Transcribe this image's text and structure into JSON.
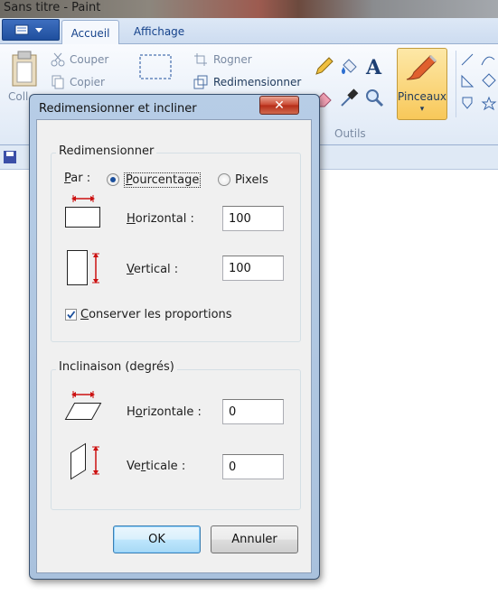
{
  "app": {
    "title": "Sans titre - Paint",
    "tabs": {
      "home": "Accueil",
      "view": "Affichage"
    },
    "ribbon": {
      "cut": "Couper",
      "copy": "Copier",
      "paste_partial": "Coll",
      "crop": "Rogner",
      "resize": "Redimensionner",
      "tools_group": "Outils",
      "brushes": "Pinceaux"
    }
  },
  "dialog": {
    "title": "Redimensionner et incliner",
    "close_glyph": "✕",
    "resize": {
      "group_title": "Redimensionner",
      "by_label": "Par :",
      "percentage_label": "Pourcentage",
      "pixels_label": "Pixels",
      "selected_unit": "Pourcentage",
      "horizontal_label": "Horizontal :",
      "horizontal_value": "100",
      "vertical_label": "Vertical :",
      "vertical_value": "100",
      "keep_ratio_label": "Conserver les proportions",
      "keep_ratio_checked": true
    },
    "skew": {
      "group_title": "Inclinaison (degrés)",
      "horizontal_label": "Horizontale :",
      "horizontal_value": "0",
      "vertical_label": "Verticale :",
      "vertical_value": "0"
    },
    "buttons": {
      "ok": "OK",
      "cancel": "Annuler"
    }
  },
  "colors": {
    "accent_blue": "#1b4f9c",
    "close_red": "#c9462f",
    "arrow_red": "#cc1111"
  },
  "icons": [
    "paint-menu-icon",
    "cut-icon",
    "copy-icon",
    "crop-icon",
    "resize-icon",
    "pencil-icon",
    "fill-icon",
    "text-icon",
    "eraser-icon",
    "color-picker-icon",
    "magnifier-icon",
    "brush-icon",
    "shape-line-icon",
    "shape-triangle-icon",
    "shape-arrow-icon",
    "save-icon",
    "resize-horizontal-icon",
    "resize-vertical-icon",
    "skew-horizontal-icon",
    "skew-vertical-icon"
  ]
}
